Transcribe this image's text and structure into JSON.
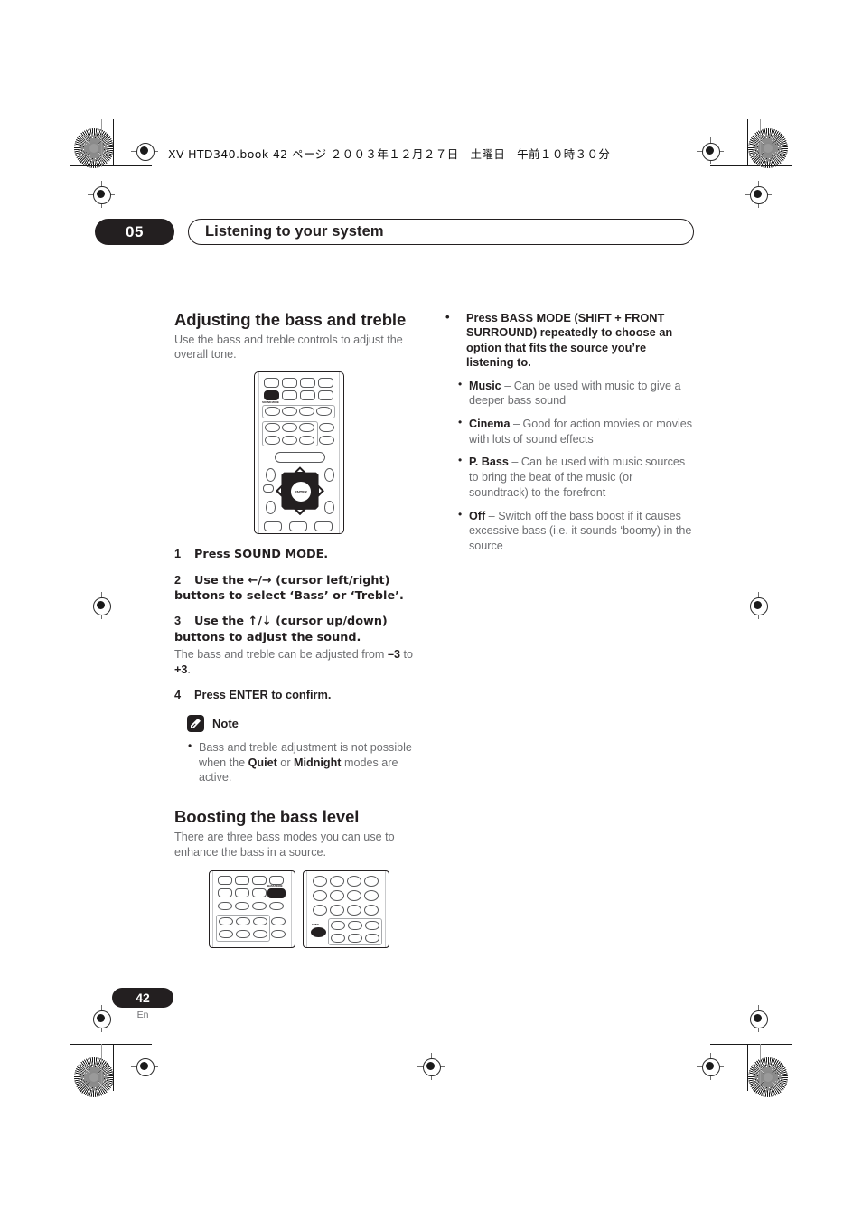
{
  "header": {
    "book_line": "XV-HTD340.book  42 ページ  ２００３年１２月２７日　土曜日　午前１０時３０分"
  },
  "chapter": {
    "number": "05",
    "title": "Listening to your system"
  },
  "left_column": {
    "section1": {
      "title": "Adjusting the bass and treble",
      "intro": "Use the bass and treble controls to adjust the overall tone.",
      "remote_labels": {
        "highlighted_button": "SOUND MODE",
        "dpad_center": "ENTER"
      },
      "steps": [
        {
          "num": "1",
          "text": "Press SOUND MODE."
        },
        {
          "num": "2",
          "text": "Use the ←/→ (cursor left/right) buttons to select ‘Bass’ or ‘Treble’."
        },
        {
          "num": "3",
          "text": "Use the ↑/↓ (cursor up/down) buttons to adjust the sound."
        },
        {
          "num": "4",
          "text": "Press ENTER to confirm."
        }
      ],
      "step3_note_pre": "The bass and treble can be adjusted from ",
      "step3_note_min": "–3",
      "step3_note_mid": " to ",
      "step3_note_max": "+3",
      "step3_note_end": "."
    },
    "note": {
      "title": "Note",
      "icon": "pencil-icon",
      "items": [
        {
          "pre": "Bass and treble adjustment is not possible when the ",
          "b1": "Quiet",
          "mid": " or ",
          "b2": "Midnight",
          "post": " modes are active."
        }
      ]
    },
    "section2": {
      "title": "Boosting the bass level",
      "intro": "There are three bass modes you can use to enhance the bass in a source.",
      "remote_labels": {
        "left_button": "BASS MODE",
        "right_button": "SHIFT"
      }
    }
  },
  "right_column": {
    "lead_bullet": "Press BASS MODE (SHIFT + FRONT SURROUND) repeatedly to choose an option that fits the source you’re listening to.",
    "options": [
      {
        "name": "Music",
        "dash": " – ",
        "desc": "Can be used with music to give a deeper bass sound"
      },
      {
        "name": "Cinema",
        "dash": " – ",
        "desc": "Good for action movies or movies with lots of sound effects"
      },
      {
        "name": "P. Bass",
        "dash": " – ",
        "desc": "Can be used with music sources to bring the beat of the music (or soundtrack) to the forefront"
      },
      {
        "name": "Off",
        "dash": " – ",
        "desc": "Switch off the bass boost if it causes excessive bass (i.e. it sounds ‘boomy) in the source"
      }
    ]
  },
  "footer": {
    "page_number": "42",
    "language": "En"
  },
  "colors": {
    "ink": "#231f20",
    "body_gray": "#6d6e71",
    "line_gray": "#a7a9ac"
  }
}
